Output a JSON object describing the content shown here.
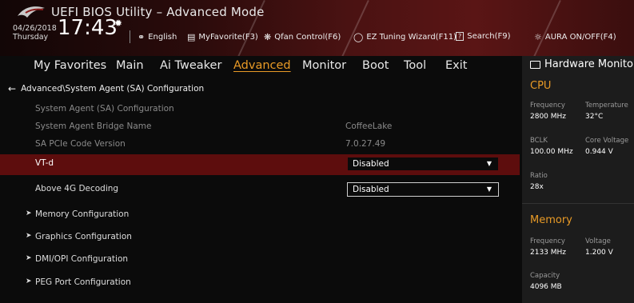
{
  "header": {
    "title": "UEFI BIOS Utility – Advanced Mode",
    "date": "04/26/2018",
    "day": "Thursday",
    "time": "17:43",
    "toolbar": {
      "language": "English",
      "myfavorite": "MyFavorite(F3)",
      "qfan": "Qfan Control(F6)",
      "ez_tuning": "EZ Tuning Wizard(F11)",
      "search": "Search(F9)",
      "aura": "AURA ON/OFF(F4)"
    }
  },
  "menu": {
    "items": [
      "My Favorites",
      "Main",
      "Ai Tweaker",
      "Advanced",
      "Monitor",
      "Boot",
      "Tool",
      "Exit"
    ],
    "active": "Advanced"
  },
  "main": {
    "breadcrumb": "Advanced\\System Agent (SA) Configuration",
    "rows": [
      {
        "label": "System Agent (SA) Configuration",
        "value": ""
      },
      {
        "label": "System Agent Bridge Name",
        "value": "CoffeeLake"
      },
      {
        "label": "SA PCIe Code Version",
        "value": "7.0.27.49"
      },
      {
        "label": "VT-d",
        "value": "Disabled"
      },
      {
        "label": "Above 4G Decoding",
        "value": "Disabled"
      }
    ],
    "submenus": [
      "Memory Configuration",
      "Graphics Configuration",
      "DMI/OPI Configuration",
      "PEG Port Configuration"
    ]
  },
  "hw_monitor": {
    "title": "Hardware Monitor",
    "cpu": {
      "heading": "CPU",
      "frequency_label": "Frequency",
      "frequency": "2800 MHz",
      "temperature_label": "Temperature",
      "temperature": "32°C",
      "bclk_label": "BCLK",
      "bclk": "100.00 MHz",
      "core_voltage_label": "Core Voltage",
      "core_voltage": "0.944 V",
      "ratio_label": "Ratio",
      "ratio": "28x"
    },
    "memory": {
      "heading": "Memory",
      "frequency_label": "Frequency",
      "frequency": "2133 MHz",
      "voltage_label": "Voltage",
      "voltage": "1.200 V",
      "capacity_label": "Capacity",
      "capacity": "4096 MB"
    }
  },
  "colors": {
    "accent": "#e89a26",
    "highlight": "#5d0d0d",
    "panel": "#1c1c1c"
  }
}
